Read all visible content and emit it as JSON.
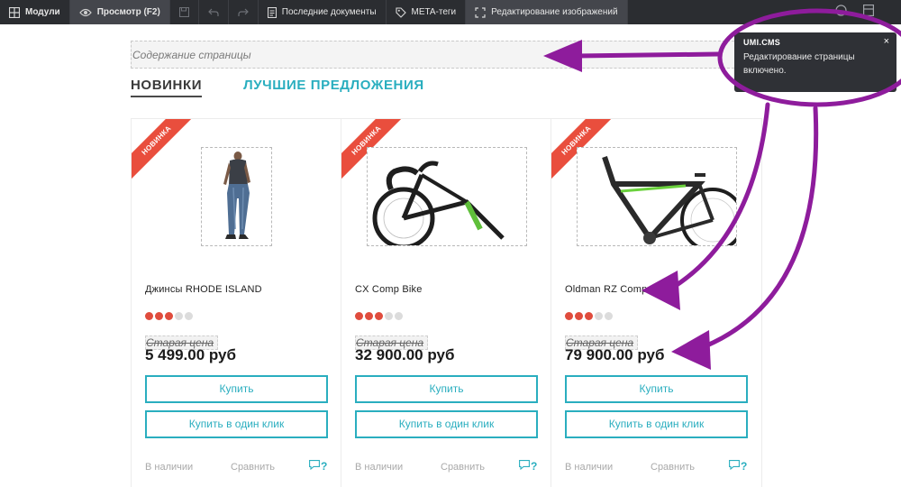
{
  "toolbar": {
    "modules_label": "Модули",
    "preview_label": "Просмотр (F2)",
    "recent_label": "Последние документы",
    "meta_label": "META-теги",
    "image_edit_label": "Редактирование изображений"
  },
  "page": {
    "content_placeholder": "Содержание страницы",
    "tabs": [
      {
        "label": "НОВИНКИ"
      },
      {
        "label": "ЛУЧШИЕ ПРЕДЛОЖЕНИЯ"
      }
    ]
  },
  "products": [
    {
      "badge": "НОВИНКА",
      "title": "Джинсы RHODE ISLAND",
      "rating": 3,
      "rating_max": 5,
      "old_price_label": "Старая цена",
      "price": "5 499.00 руб",
      "buy_label": "Купить",
      "one_click_label": "Купить в один клик",
      "availability": "В наличии",
      "compare_label": "Сравнить",
      "help_mark": "?"
    },
    {
      "badge": "НОВИНКА",
      "title": "CX Comp Bike",
      "rating": 3,
      "rating_max": 5,
      "old_price_label": "Старая цена",
      "price": "32 900.00 руб",
      "buy_label": "Купить",
      "one_click_label": "Купить в один клик",
      "availability": "В наличии",
      "compare_label": "Сравнить",
      "help_mark": "?"
    },
    {
      "badge": "НОВИНКА",
      "title": "Oldman RZ Comp",
      "rating": 3,
      "rating_max": 5,
      "old_price_label": "Старая цена",
      "price": "79 900.00 руб",
      "buy_label": "Купить",
      "one_click_label": "Купить в один клик",
      "availability": "В наличии",
      "compare_label": "Сравнить",
      "help_mark": "?"
    }
  ],
  "notification": {
    "title": "UMI.CMS",
    "text": "Редактирование страницы включено.",
    "close": "×"
  },
  "colors": {
    "toolbar_bg": "#2b2d31",
    "accent": "#2aaebf",
    "badge": "#e94e3d",
    "star_on": "#e04c3d",
    "annotation": "#8e1c9c"
  }
}
